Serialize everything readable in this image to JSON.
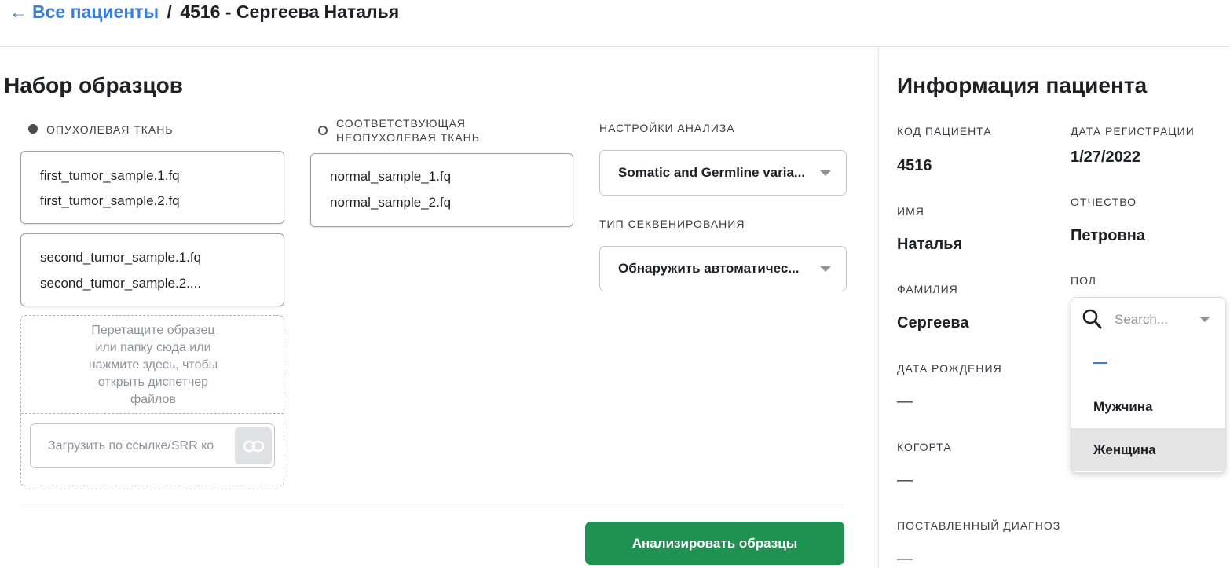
{
  "breadcrumb": {
    "back_arrow": "←",
    "back_label": "Все пациенты",
    "separator": "/",
    "current": "4516 - Сергеева Наталья"
  },
  "samples": {
    "title": "Набор образцов",
    "tumor_label": "ОПУХОЛЕВАЯ ТКАНЬ",
    "normal_label_line1": "СООТВЕТСТВУЮЩАЯ",
    "normal_label_line2": "НЕОПУХОЛЕВАЯ ТКАНЬ",
    "tumor_groups": [
      [
        "first_tumor_sample.1.fq",
        "first_tumor_sample.2.fq"
      ],
      [
        "second_tumor_sample.1.fq",
        "second_tumor_sample.2...."
      ]
    ],
    "normal_groups": [
      [
        "normal_sample_1.fq",
        "normal_sample_2.fq"
      ]
    ],
    "dropzone_lines": [
      "Перетащите образец",
      "или папку сюда или",
      "нажмите здесь, чтобы",
      "открыть диспетчер",
      "файлов"
    ],
    "url_placeholder": "Загрузить по ссылке/SRR ко",
    "link_icon": "link-icon"
  },
  "analysis": {
    "settings_label": "НАСТРОЙКИ АНАЛИЗА",
    "settings_value": "Somatic and Germline varia...",
    "sequencing_label": "ТИП СЕКВЕНИРОВАНИЯ",
    "sequencing_value": "Обнаружить автоматичес...",
    "analyze_button": "Анализировать образцы",
    "accent_color": "#1f9150"
  },
  "patient": {
    "title": "Информация пациента",
    "code_label": "КОД ПАЦИЕНТА",
    "code_value": "4516",
    "reg_date_label": "ДАТА РЕГИСТРАЦИИ",
    "reg_date_value": "1/27/2022",
    "first_name_label": "ИМЯ",
    "first_name_value": "Наталья",
    "patronymic_label": "ОТЧЕСТВО",
    "patronymic_value": "Петровна",
    "last_name_label": "ФАМИЛИЯ",
    "last_name_value": "Сергеева",
    "sex_label": "ПОЛ",
    "birth_date_label": "ДАТА РОЖДЕНИЯ",
    "birth_date_value": "—",
    "cohort_label": "КОГОРТА",
    "cohort_value": "—",
    "diagnosis_label": "ПОСТАВЛЕННЫЙ ДИАГНОЗ",
    "diagnosis_value": "—"
  },
  "sex_dropdown": {
    "search_placeholder": "Search...",
    "options": [
      "Мужчина",
      "Женщина"
    ],
    "selected": "Женщина",
    "empty_option_color": "#3b7de0"
  }
}
